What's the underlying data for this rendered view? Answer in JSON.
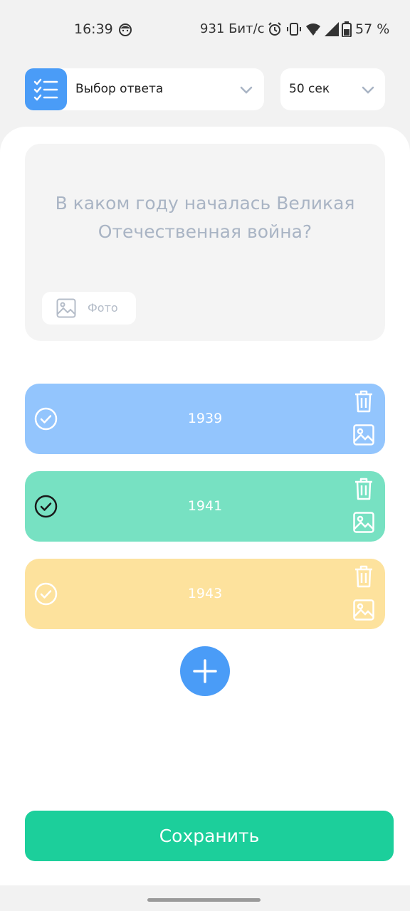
{
  "status_bar": {
    "time": "16:39",
    "net_speed": "931 Бит/с",
    "battery": "57 %",
    "icons": [
      "face-icon",
      "alarm-icon",
      "vibrate-icon",
      "wifi-icon",
      "signal-icon",
      "battery-icon"
    ]
  },
  "toolbar": {
    "question_type": "Выбор ответа",
    "time_limit": "50 сек"
  },
  "question": {
    "text": "В каком году началась Великая Отечественная война?",
    "photo_label": "Фото"
  },
  "answers": [
    {
      "text": "1939",
      "color": "#93c5fd",
      "correct": false
    },
    {
      "text": "1941",
      "color": "#77e1c2",
      "correct": true
    },
    {
      "text": "1943",
      "color": "#fde29d",
      "correct": false
    }
  ],
  "save_label": "Сохранить",
  "colors": {
    "accent_blue": "#4a9cf7",
    "accent_green": "#1ccf9b",
    "background": "#f2f2f2"
  }
}
